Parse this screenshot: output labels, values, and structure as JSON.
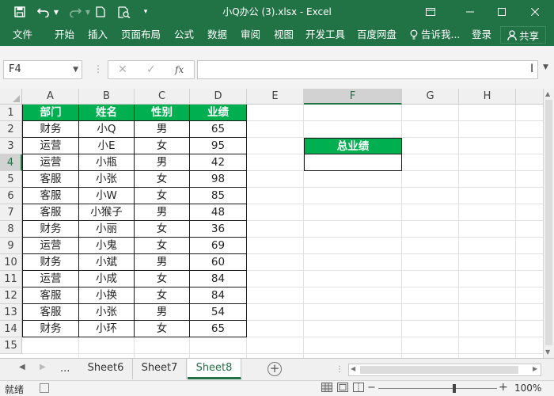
{
  "window": {
    "title": "小Q办公 (3).xlsx - Excel"
  },
  "ribbon": {
    "tabs": [
      "文件",
      "开始",
      "插入",
      "页面布局",
      "公式",
      "数据",
      "审阅",
      "视图",
      "开发工具",
      "百度网盘",
      "告诉我..."
    ],
    "login": "登录",
    "share": "共享"
  },
  "formula_bar": {
    "name_box": "F4",
    "fx_label": "fx",
    "value": ""
  },
  "grid": {
    "columns": [
      "A",
      "B",
      "C",
      "D",
      "E",
      "F",
      "G",
      "H"
    ],
    "rows": [
      "1",
      "2",
      "3",
      "4",
      "5",
      "6",
      "7",
      "8",
      "9",
      "10",
      "11",
      "12",
      "13",
      "14",
      "15"
    ],
    "selected_cell": "F4",
    "table": {
      "headers": [
        "部门",
        "姓名",
        "性别",
        "业绩"
      ],
      "rows": [
        [
          "财务",
          "小Q",
          "男",
          "65"
        ],
        [
          "运营",
          "小E",
          "女",
          "95"
        ],
        [
          "运营",
          "小瓶",
          "男",
          "42"
        ],
        [
          "客服",
          "小张",
          "女",
          "98"
        ],
        [
          "客服",
          "小W",
          "女",
          "85"
        ],
        [
          "客服",
          "小猴子",
          "男",
          "48"
        ],
        [
          "财务",
          "小丽",
          "女",
          "36"
        ],
        [
          "运营",
          "小鬼",
          "女",
          "69"
        ],
        [
          "财务",
          "小斌",
          "男",
          "60"
        ],
        [
          "运营",
          "小成",
          "女",
          "84"
        ],
        [
          "客服",
          "小换",
          "女",
          "84"
        ],
        [
          "客服",
          "小张",
          "男",
          "54"
        ],
        [
          "财务",
          "小环",
          "女",
          "65"
        ]
      ]
    },
    "summary": {
      "header": "总业绩",
      "value": ""
    },
    "header_color": "#00b050"
  },
  "sheets": {
    "more": "...",
    "tabs": [
      "Sheet6",
      "Sheet7",
      "Sheet8"
    ],
    "active": "Sheet8"
  },
  "status": {
    "ready": "就绪",
    "zoom": "100%"
  },
  "colors": {
    "brand": "#217346",
    "table_header": "#00b050"
  }
}
